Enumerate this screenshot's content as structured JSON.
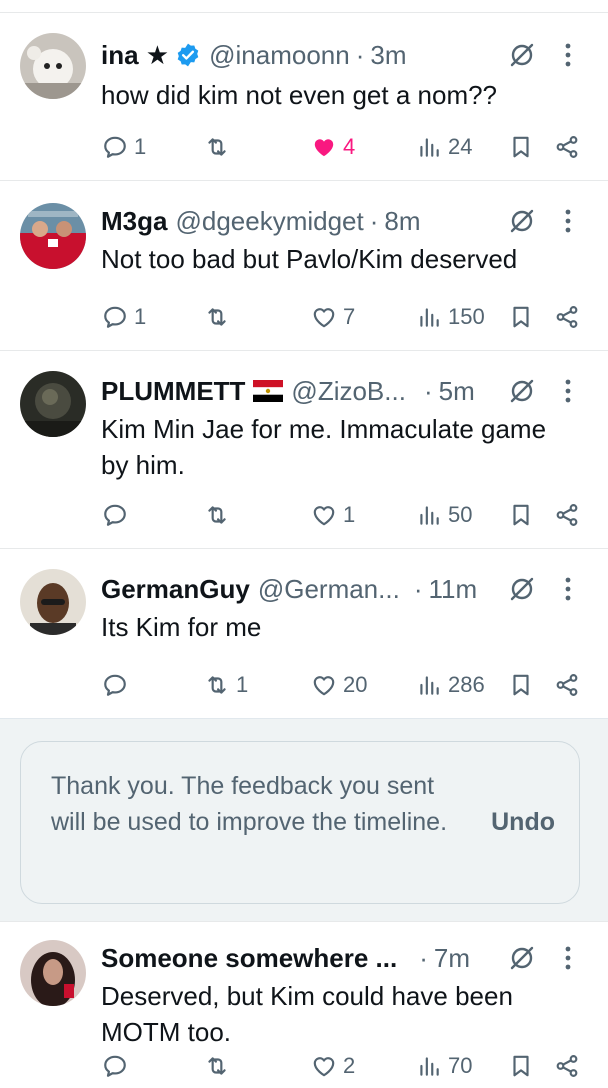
{
  "tweets": [
    {
      "name": "ina ★",
      "handle": "@inamoonn",
      "dot": "·",
      "time": "3m",
      "verified": true,
      "text": "how did kim not even get a nom??",
      "actions": {
        "reply": "1",
        "retweet": "",
        "like": "4",
        "liked": true,
        "views": "24"
      }
    },
    {
      "name": "M3ga",
      "handle": "@dgeekymidget",
      "dot": "·",
      "time": "8m",
      "text": "Not too bad but Pavlo/Kim deserved",
      "actions": {
        "reply": "1",
        "retweet": "",
        "like": "7",
        "views": "150"
      }
    },
    {
      "name": "PLUMMETT",
      "flag": "egypt-flag-icon",
      "handle": "@ZizoB...",
      "dot": "·",
      "time": "5m",
      "text": "Kim Min Jae for me. Immaculate game by him.",
      "actions": {
        "reply": "",
        "retweet": "",
        "like": "1",
        "views": "50"
      }
    },
    {
      "name": "GermanGuy",
      "handle": "@German...",
      "dot": "·",
      "time": "11m",
      "text": "Its Kim for me",
      "actions": {
        "reply": "",
        "retweet": "1",
        "like": "20",
        "views": "286"
      }
    },
    {
      "name": "Someone somewhere ...",
      "handle": "",
      "dot": "·",
      "time": "7m",
      "text": "Deserved, but Kim could have been MOTM too.",
      "actions": {
        "reply": "",
        "retweet": "",
        "like": "2",
        "views": "70"
      }
    }
  ],
  "feedback": {
    "message": "Thank you. The feedback you sent will be used to improve the timeline.",
    "undo_label": "Undo"
  },
  "colors": {
    "text": "#0f1419",
    "secondary": "#536471",
    "like": "#f91880",
    "verified": "#1d9bf0",
    "divider": "#e7e9ea",
    "feedback_bg": "#eff3f4"
  }
}
